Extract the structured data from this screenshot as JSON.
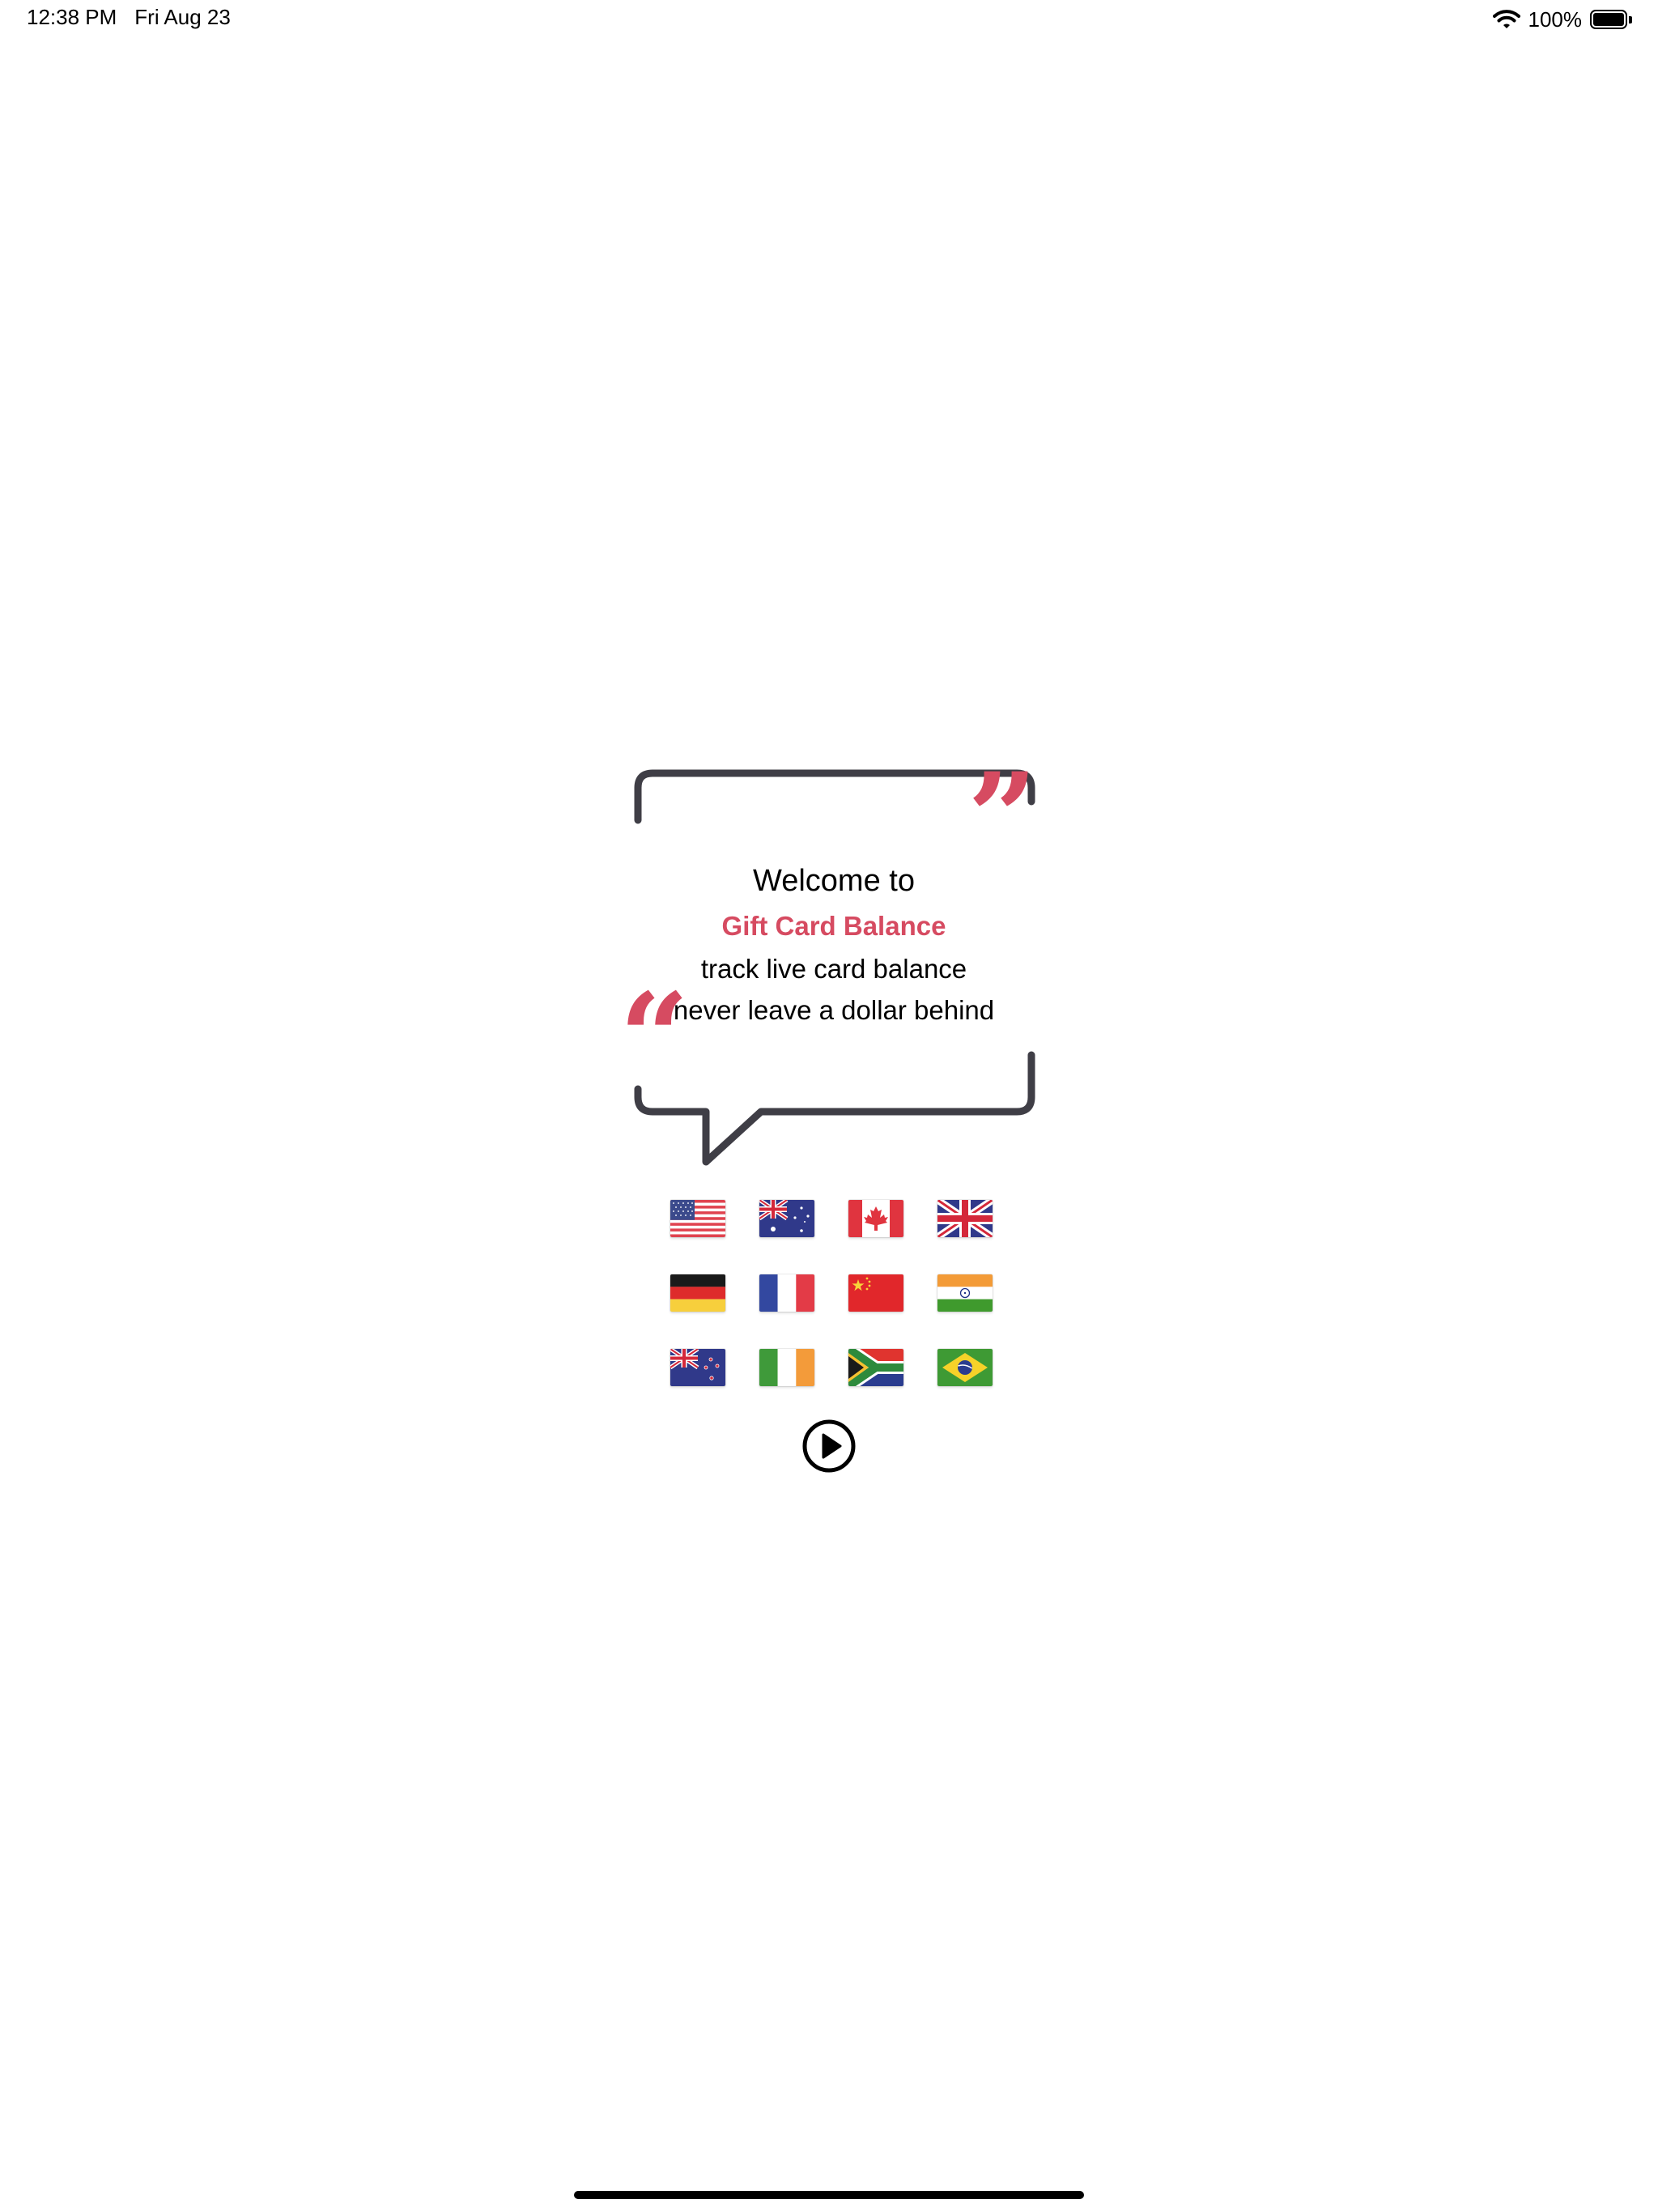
{
  "status_bar": {
    "time": "12:38 PM",
    "date": "Fri Aug 23",
    "battery_percent": "100%",
    "battery_level": 1.0
  },
  "welcome": {
    "line1": "Welcome to",
    "app_name": "Gift Card Balance",
    "tagline1": "track live card balance",
    "tagline2": "never leave a dollar behind",
    "quote_open": "“",
    "quote_close": "”"
  },
  "colors": {
    "accent": "#d64b61",
    "bubble_stroke": "#3f3e46",
    "text": "#000000"
  },
  "flags": [
    {
      "name": "flag-usa-icon"
    },
    {
      "name": "flag-australia-icon"
    },
    {
      "name": "flag-canada-icon"
    },
    {
      "name": "flag-uk-icon"
    },
    {
      "name": "flag-germany-icon"
    },
    {
      "name": "flag-france-icon"
    },
    {
      "name": "flag-china-icon"
    },
    {
      "name": "flag-india-icon"
    },
    {
      "name": "flag-new-zealand-icon"
    },
    {
      "name": "flag-ireland-icon"
    },
    {
      "name": "flag-south-africa-icon"
    },
    {
      "name": "flag-brazil-icon"
    }
  ],
  "start_button": {
    "icon": "play-circle-icon"
  }
}
